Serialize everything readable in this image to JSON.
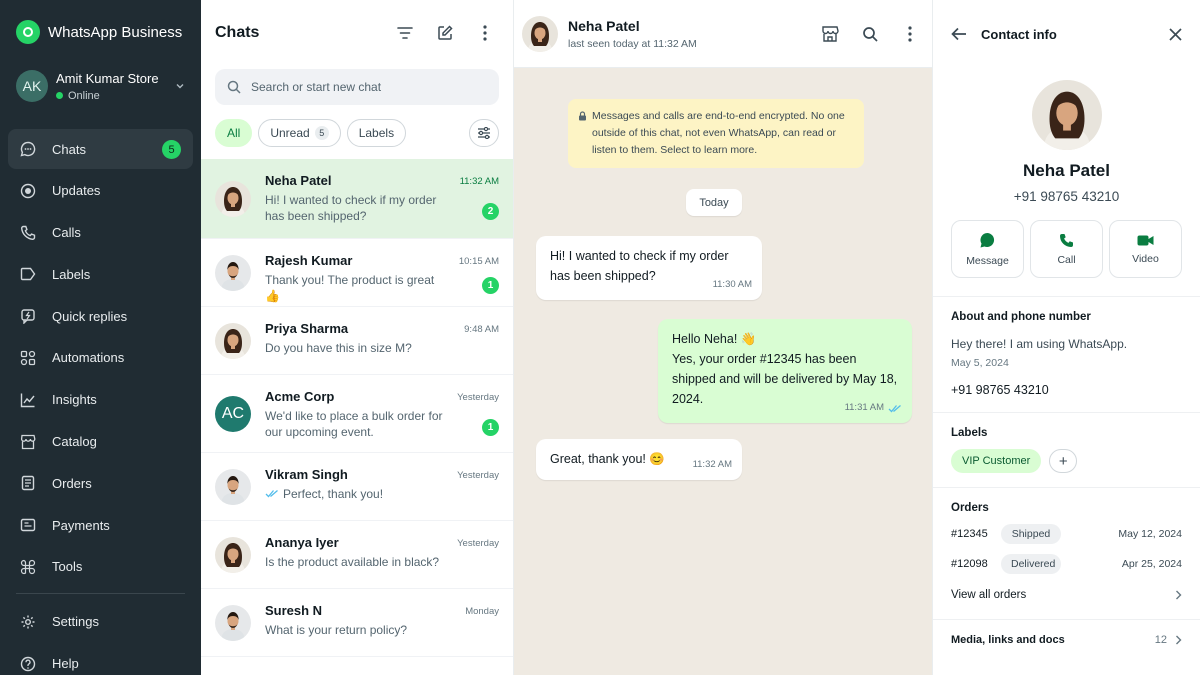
{
  "app": {
    "brand": "WhatsApp Business"
  },
  "account": {
    "initials": "AK",
    "store_name": "Amit Kumar Store",
    "status": "Online"
  },
  "nav": [
    {
      "label": "Chats",
      "icon": "chat-icon",
      "badge": "5",
      "active": true
    },
    {
      "label": "Updates",
      "icon": "status-icon"
    },
    {
      "label": "Calls",
      "icon": "phone-icon"
    },
    {
      "label": "Labels",
      "icon": "label-icon"
    },
    {
      "label": "Quick replies",
      "icon": "quick-reply-icon"
    },
    {
      "label": "Automations",
      "icon": "automation-icon"
    },
    {
      "label": "Insights",
      "icon": "insights-icon"
    },
    {
      "label": "Catalog",
      "icon": "catalog-icon"
    },
    {
      "label": "Orders",
      "icon": "orders-icon"
    },
    {
      "label": "Payments",
      "icon": "payments-icon"
    },
    {
      "label": "Tools",
      "icon": "tools-icon"
    }
  ],
  "nav_bottom": [
    {
      "label": "Settings",
      "icon": "gear-icon"
    },
    {
      "label": "Help",
      "icon": "help-icon"
    }
  ],
  "chatlist": {
    "title": "Chats",
    "search_placeholder": "Search or start new chat",
    "filters": [
      {
        "label": "All",
        "active": true
      },
      {
        "label": "Unread",
        "count": "5"
      },
      {
        "label": "Labels"
      }
    ],
    "chats": [
      {
        "name": "Neha Patel",
        "preview": "Hi! I wanted to check if my order has been shipped?",
        "time": "11:32 AM",
        "unread": "2",
        "active": true,
        "avatar": "photo-f"
      },
      {
        "name": "Rajesh Kumar",
        "preview": "Thank you! The product is great 👍",
        "time": "10:15 AM",
        "unread": "1",
        "avatar": "photo-m"
      },
      {
        "name": "Priya Sharma",
        "preview": "Do you have this in size M?",
        "time": "9:48 AM",
        "avatar": "photo-f"
      },
      {
        "name": "Acme Corp",
        "preview": "We'd like to place a bulk order for our upcoming event.",
        "time": "Yesterday",
        "unread": "1",
        "initials": "AC"
      },
      {
        "name": "Vikram Singh",
        "preview": "Perfect, thank you!",
        "time": "Yesterday",
        "ticks": true,
        "avatar": "photo-m"
      },
      {
        "name": "Ananya Iyer",
        "preview": "Is the product available in black?",
        "time": "Yesterday",
        "avatar": "photo-f"
      },
      {
        "name": "Suresh N",
        "preview": "What is your return policy?",
        "time": "Monday",
        "avatar": "photo-m"
      }
    ]
  },
  "conversation": {
    "name": "Neha Patel",
    "last_seen": "last seen today at 11:32 AM",
    "encryption_notice": "Messages and calls are end-to-end encrypted. No one outside of this chat, not even WhatsApp, can read or listen to them. Select to learn more.",
    "day": "Today",
    "messages": [
      {
        "dir": "in",
        "text": "Hi! I wanted to check if my order has been shipped?",
        "time": "11:30 AM"
      },
      {
        "dir": "out",
        "lines": [
          "Hello Neha! 👋",
          "Yes, your order #12345 has been shipped and will be delivered by May 18, 2024."
        ],
        "time": "11:31 AM"
      },
      {
        "dir": "in",
        "text": "Great, thank you! 😊",
        "time": "11:32 AM"
      }
    ]
  },
  "contact": {
    "title": "Contact info",
    "name": "Neha Patel",
    "phone": "+91 98765 43210",
    "actions": [
      "Message",
      "Call",
      "Video"
    ],
    "about_title": "About and phone number",
    "about": "Hey there! I am using WhatsApp.",
    "about_date": "May 5, 2024",
    "labels_title": "Labels",
    "labels": [
      "VIP Customer"
    ],
    "orders_title": "Orders",
    "orders": [
      {
        "id": "#12345",
        "status": "Shipped",
        "date": "May 12, 2024"
      },
      {
        "id": "#12098",
        "status": "Delivered",
        "date": "Apr 25, 2024"
      }
    ],
    "view_all": "View all orders",
    "media_title": "Media, links and docs",
    "media_count": "12"
  },
  "colors": {
    "sidebar": "#202c33",
    "accent": "#25d366",
    "chat_bg": "#efeae2",
    "out_bubble": "#d9fdd3"
  }
}
